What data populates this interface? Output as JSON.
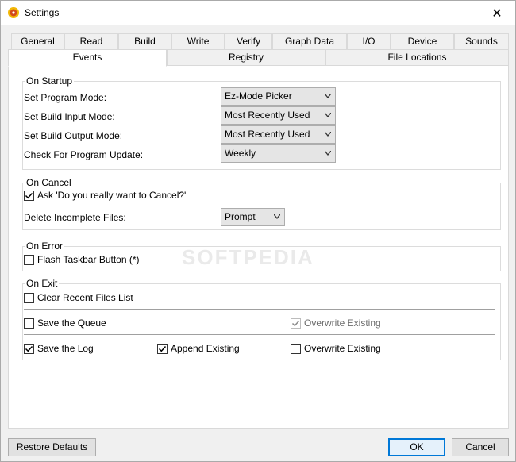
{
  "window": {
    "title": "Settings"
  },
  "tabs": {
    "row1": [
      "General",
      "Read",
      "Build",
      "Write",
      "Verify",
      "Graph Data",
      "I/O",
      "Device",
      "Sounds"
    ],
    "row2": [
      "Events",
      "Registry",
      "File Locations"
    ],
    "active": "Events"
  },
  "watermark": "SOFTPEDIA",
  "on_startup": {
    "title": "On Startup",
    "rows": [
      {
        "label": "Set Program Mode:",
        "value": "Ez-Mode Picker"
      },
      {
        "label": "Set Build Input Mode:",
        "value": "Most Recently Used"
      },
      {
        "label": "Set Build Output Mode:",
        "value": "Most Recently Used"
      },
      {
        "label": "Check For Program Update:",
        "value": "Weekly"
      }
    ]
  },
  "on_cancel": {
    "title": "On Cancel",
    "ask_cancel": {
      "label": "Ask 'Do you really want to Cancel?'",
      "checked": true
    },
    "delete_label": "Delete Incomplete Files:",
    "delete_value": "Prompt"
  },
  "on_error": {
    "title": "On Error",
    "flash_taskbar": {
      "label": "Flash Taskbar Button (*)",
      "checked": false
    }
  },
  "on_exit": {
    "title": "On Exit",
    "clear_recent": {
      "label": "Clear Recent Files List",
      "checked": false
    },
    "save_queue": {
      "label": "Save the Queue",
      "checked": false
    },
    "queue_overwrite": {
      "label": "Overwrite Existing",
      "checked": true,
      "disabled": true
    },
    "save_log": {
      "label": "Save the Log",
      "checked": true
    },
    "log_append": {
      "label": "Append Existing",
      "checked": true
    },
    "log_overwrite": {
      "label": "Overwrite Existing",
      "checked": false
    }
  },
  "buttons": {
    "restore_defaults": "Restore Defaults",
    "ok": "OK",
    "cancel": "Cancel"
  }
}
